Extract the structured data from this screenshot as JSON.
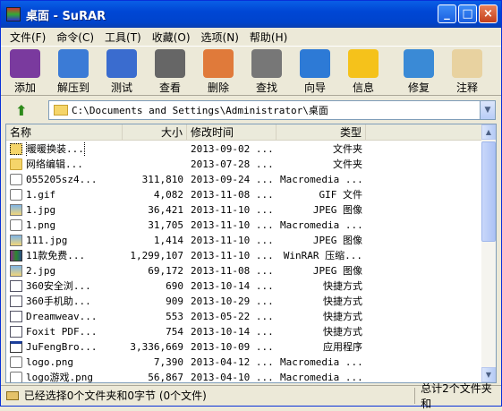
{
  "window": {
    "title": "桌面 - SuRAR",
    "min_label": "_",
    "max_label": "□",
    "close_label": "×"
  },
  "menu": [
    "文件(F)",
    "命令(C)",
    "工具(T)",
    "收藏(O)",
    "选项(N)",
    "帮助(H)"
  ],
  "toolbar": [
    {
      "label": "添加",
      "icon": "add-archive-icon",
      "color": "#7a3a9e"
    },
    {
      "label": "解压到",
      "icon": "extract-icon",
      "color": "#3b7bd6"
    },
    {
      "label": "测试",
      "icon": "test-icon",
      "color": "#3a6ccf"
    },
    {
      "label": "查看",
      "icon": "view-icon",
      "color": "#666666"
    },
    {
      "label": "删除",
      "icon": "delete-icon",
      "color": "#e07a3a"
    },
    {
      "label": "查找",
      "icon": "find-icon",
      "color": "#777777"
    },
    {
      "label": "向导",
      "icon": "wizard-icon",
      "color": "#2d7ad6"
    },
    {
      "label": "信息",
      "icon": "info-icon",
      "color": "#f5c21b"
    },
    {
      "label": "修复",
      "icon": "repair-icon",
      "color": "#3a8ad6"
    },
    {
      "label": "注释",
      "icon": "comment-icon",
      "color": "#e8d2a0"
    }
  ],
  "address": {
    "path": "C:\\Documents and Settings\\Administrator\\桌面"
  },
  "columns": {
    "name": "名称",
    "size": "大小",
    "time": "修改时间",
    "type": "类型"
  },
  "files": [
    {
      "name": "暖暖换装...",
      "size": "",
      "time": "2013-09-02 ...",
      "type": "文件夹",
      "icon": "folder"
    },
    {
      "name": "网络编辑...",
      "size": "",
      "time": "2013-07-28 ...",
      "type": "文件夹",
      "icon": "folder"
    },
    {
      "name": "055205sz4...",
      "size": "311,810",
      "time": "2013-09-24 ...",
      "type": "Macromedia ...",
      "icon": "flash"
    },
    {
      "name": "1.gif",
      "size": "4,082",
      "time": "2013-11-08 ...",
      "type": "GIF 文件",
      "icon": "flash"
    },
    {
      "name": "1.jpg",
      "size": "36,421",
      "time": "2013-11-10 ...",
      "type": "JPEG 图像",
      "icon": "image"
    },
    {
      "name": "1.png",
      "size": "31,705",
      "time": "2013-11-10 ...",
      "type": "Macromedia ...",
      "icon": "flash"
    },
    {
      "name": "111.jpg",
      "size": "1,414",
      "time": "2013-11-10 ...",
      "type": "JPEG 图像",
      "icon": "image"
    },
    {
      "name": "11款免费...",
      "size": "1,299,107",
      "time": "2013-11-10 ...",
      "type": "WinRAR 压缩...",
      "icon": "archive"
    },
    {
      "name": "2.jpg",
      "size": "69,172",
      "time": "2013-11-08 ...",
      "type": "JPEG 图像",
      "icon": "image"
    },
    {
      "name": "360安全浏...",
      "size": "690",
      "time": "2013-10-14 ...",
      "type": "快捷方式",
      "icon": "shortcut"
    },
    {
      "name": "360手机助...",
      "size": "909",
      "time": "2013-10-29 ...",
      "type": "快捷方式",
      "icon": "shortcut"
    },
    {
      "name": "Dreamweav...",
      "size": "553",
      "time": "2013-05-22 ...",
      "type": "快捷方式",
      "icon": "shortcut"
    },
    {
      "name": "Foxit PDF...",
      "size": "754",
      "time": "2013-10-14 ...",
      "type": "快捷方式",
      "icon": "shortcut"
    },
    {
      "name": "JuFengBro...",
      "size": "3,336,669",
      "time": "2013-10-09 ...",
      "type": "应用程序",
      "icon": "exe"
    },
    {
      "name": "logo.png",
      "size": "7,390",
      "time": "2013-04-12 ...",
      "type": "Macromedia ...",
      "icon": "flash"
    },
    {
      "name": "logo游戏.png",
      "size": "56,867",
      "time": "2013-04-10 ...",
      "type": "Macromedia ...",
      "icon": "flash"
    }
  ],
  "status": {
    "left": "已经选择0个文件夹和0字节 (0个文件)",
    "right": "总计2个文件夹和"
  }
}
